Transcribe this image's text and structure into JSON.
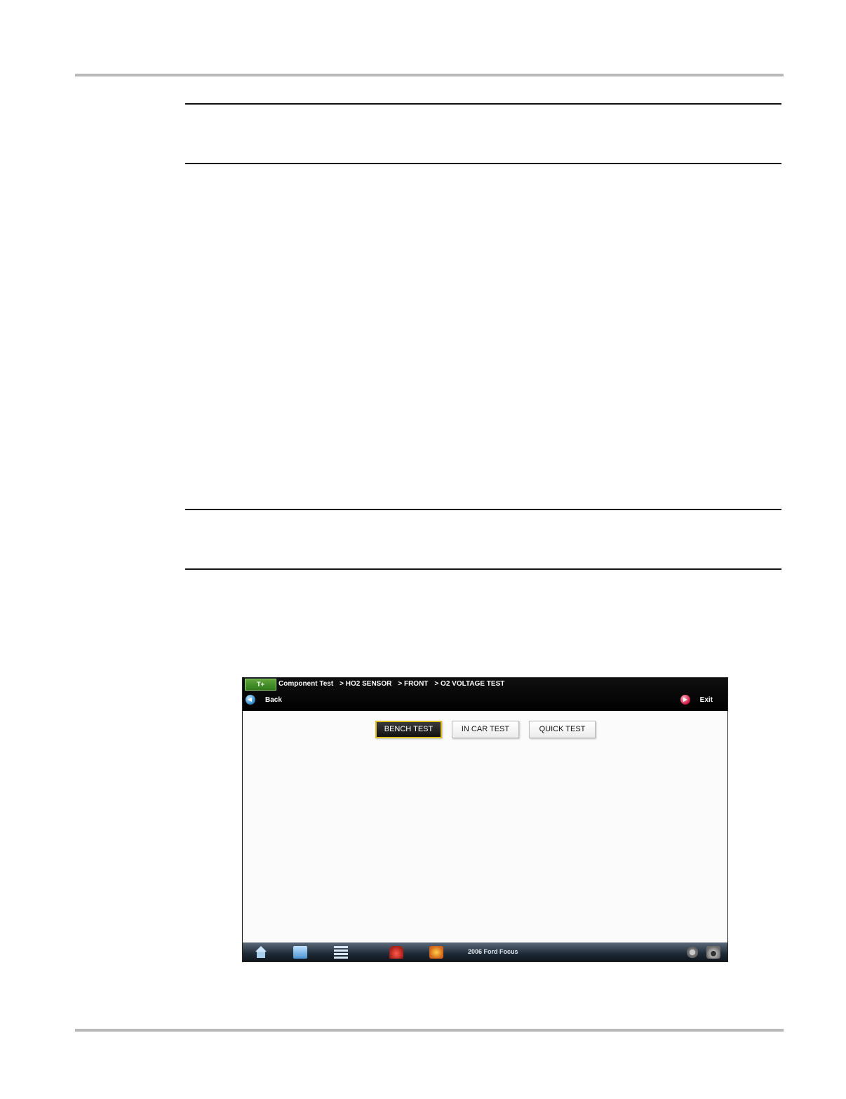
{
  "topbar": {
    "logo_text": "T+",
    "breadcrumbs": [
      "Component Test",
      "> HO2 SENSOR",
      "> FRONT",
      "> O2 VOLTAGE TEST"
    ],
    "back_label": "Back",
    "exit_label": "Exit"
  },
  "tabs": [
    {
      "label": "BENCH TEST",
      "active": true
    },
    {
      "label": "IN CAR TEST",
      "active": false
    },
    {
      "label": "QUICK TEST",
      "active": false
    }
  ],
  "bottombar": {
    "vehicle": "2006 Ford Focus",
    "icons": [
      "home-icon",
      "list-icon",
      "tools-icon",
      "car-icon",
      "engine-icon",
      "gear-icon",
      "camera-icon"
    ]
  }
}
